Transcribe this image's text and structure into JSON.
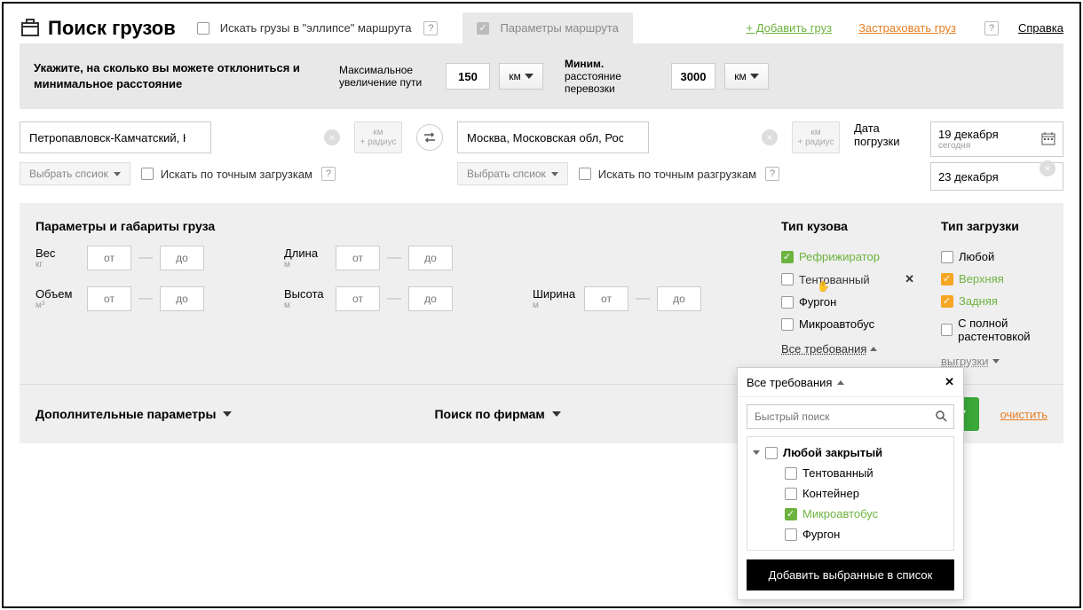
{
  "header": {
    "title": "Поиск грузов",
    "ellipse_label": "Искать грузы в \"эллипсе\" маршрута",
    "route_params_label": "Параметры маршрута",
    "add_cargo": "+ Добавить груз",
    "insure_cargo": "Застраховать груз",
    "help": "Справка"
  },
  "route": {
    "instruction": "Укажите, на сколько вы можете отклониться и минимальное расстояние",
    "max_label": "Максимальное увеличение пути",
    "max_value": "150",
    "max_unit": "км",
    "min_label_bold": "Миним.",
    "min_label_rest": " расстояние перевозки",
    "min_value": "3000",
    "min_unit": "км"
  },
  "from": {
    "value": "Петропавловск-Камчатский, Камчатский авт",
    "radius_unit": "км",
    "radius_label": "+ радиус",
    "select_list": "Выбрать спсиок",
    "exact_label": "Искать по точным загрузкам"
  },
  "to": {
    "value": "Москва, Московская обл, Россия",
    "radius_unit": "км",
    "radius_label": "+ радиус",
    "select_list": "Выбрать спсиок",
    "exact_label": "Искать по точным разгрузкам"
  },
  "dates": {
    "label": "Дата погрузки",
    "date1": "19 декабря",
    "date1_sub": "сегодня",
    "date2": "23 декабря"
  },
  "params": {
    "title": "Параметры и габариты груза",
    "weight": "Вес",
    "weight_unit": "кг",
    "volume": "Объем",
    "volume_unit": "м³",
    "length": "Длина",
    "length_unit": "м",
    "height": "Высота",
    "height_unit": "м",
    "width": "Ширина",
    "width_unit": "м",
    "from_ph": "от",
    "to_ph": "до"
  },
  "body_type": {
    "title": "Тип кузова",
    "items": [
      "Рефрижиратор",
      "Тентованный",
      "Фургон",
      "Микроавтобус"
    ],
    "all_link": "Все требования"
  },
  "load_type": {
    "title": "Тип загрузки",
    "items": [
      "Любой",
      "Верхняя",
      "Задняя",
      "С полной растентовкой"
    ],
    "unload_link": "выгрузки"
  },
  "bottom": {
    "extra": "Дополнительные параметры",
    "firms": "Поиск по фирмам",
    "clear": "очистить"
  },
  "dropdown": {
    "title": "Все требования",
    "search_ph": "Быстрый поиск",
    "parent": "Любой закрытый",
    "children": [
      "Тентованный",
      "Контейнер",
      "Микроавтобус",
      "Фургон"
    ],
    "submit": "Добавить выбранные в список"
  }
}
